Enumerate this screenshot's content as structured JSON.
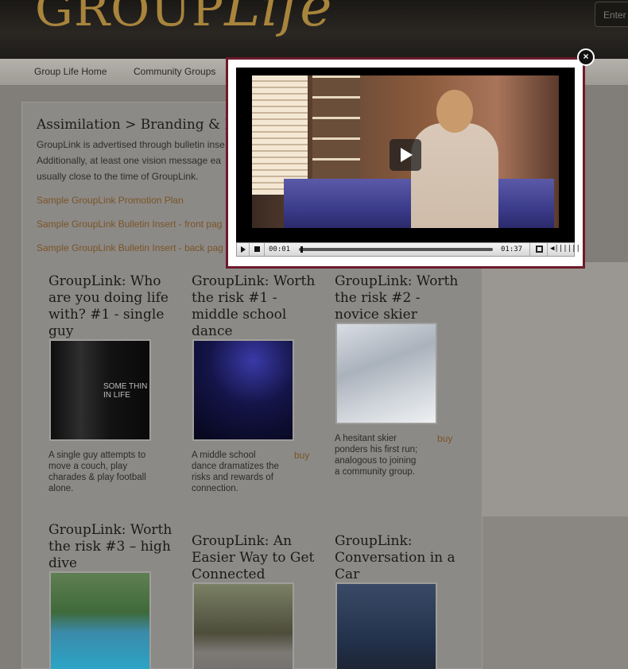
{
  "header": {
    "logo_group": "GROUP",
    "logo_life": "Life",
    "search_placeholder": "Enter"
  },
  "nav": {
    "items": [
      "Group Life Home",
      "Community Groups"
    ]
  },
  "page": {
    "title": "Assimilation > Branding & Pro",
    "intro_lines": [
      "GroupLink is advertised through bulletin inse",
      "Additionally, at least one vision message ea",
      "usually close to the time of GroupLink."
    ],
    "links": [
      "Sample GroupLink Promotion Plan",
      "Sample GroupLink Bulletin Insert - front pag",
      "Sample GroupLink Bulletin Insert - back pag"
    ]
  },
  "cards": [
    {
      "title": "GroupLink: Who are you doing life with? #1 - single guy",
      "desc": "A single guy attempts to move a couch, play charades & play football alone.",
      "buy": "",
      "thumb_text": "SOME THIN\nIN LIFE"
    },
    {
      "title": "GroupLink: Worth the risk #1 - middle school dance",
      "desc": "A middle school dance dramatizes the risks and rewards of connection.",
      "buy": "buy"
    },
    {
      "title": "GroupLink: Worth the risk #2 - novice skier",
      "desc": "A hesitant skier ponders his first run; analogous to joining a community group.",
      "buy": "buy"
    },
    {
      "title": "GroupLink: Worth the risk #3 – high dive",
      "desc": "",
      "buy": ""
    },
    {
      "title": "GroupLink: An Easier Way to Get Connected",
      "desc": "",
      "buy": ""
    },
    {
      "title": "GroupLink: Conversation in a Car",
      "desc": "",
      "buy": ""
    }
  ],
  "modal": {
    "close_label": "×",
    "current_time": "00:01",
    "duration": "01:37",
    "progress_fraction": 0.01
  }
}
